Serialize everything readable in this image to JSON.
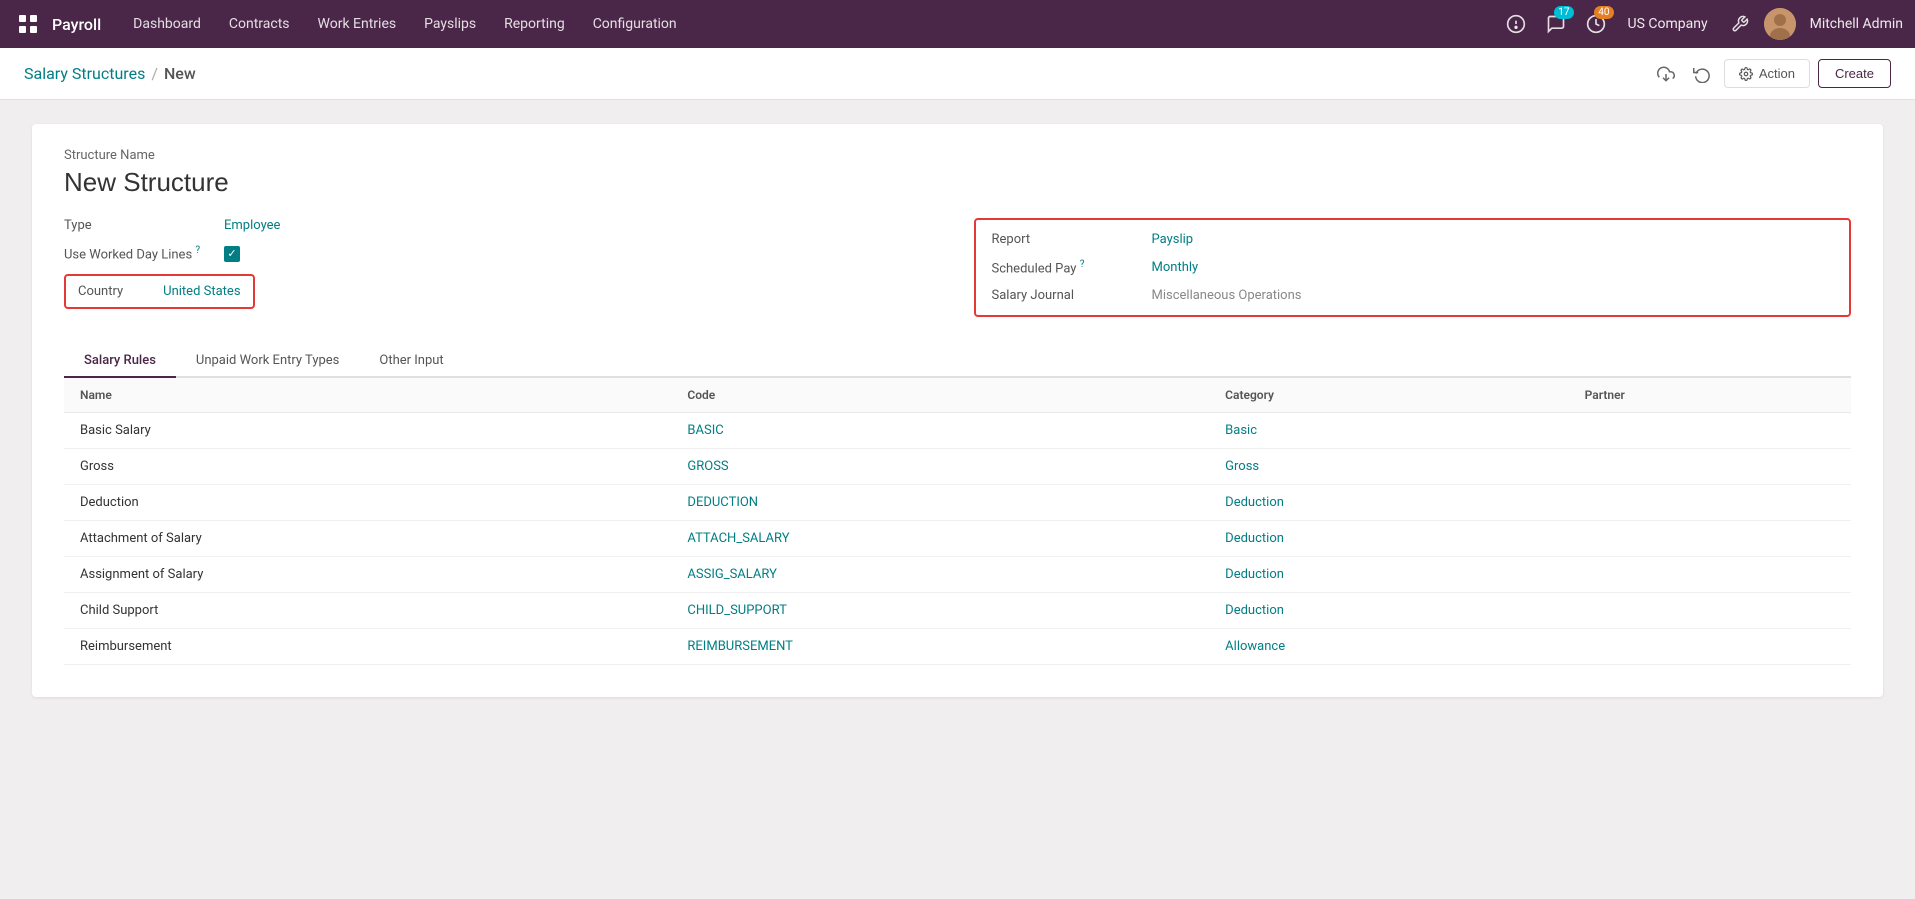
{
  "app": {
    "name": "Payroll",
    "nav_items": [
      "Dashboard",
      "Contracts",
      "Work Entries",
      "Payslips",
      "Reporting",
      "Configuration"
    ]
  },
  "topbar": {
    "chat_badge": "17",
    "activity_badge": "40",
    "company": "US Company",
    "user": "Mitchell Admin"
  },
  "breadcrumb": {
    "parent": "Salary Structures",
    "current": "New"
  },
  "toolbar": {
    "action_label": "Action",
    "create_label": "Create"
  },
  "form": {
    "structure_name_label": "Structure Name",
    "structure_name": "New Structure",
    "type_label": "Type",
    "type_value": "Employee",
    "use_worked_day_lines_label": "Use Worked Day Lines",
    "country_label": "Country",
    "country_value": "United States",
    "report_label": "Report",
    "report_value": "Payslip",
    "scheduled_pay_label": "Scheduled Pay",
    "scheduled_pay_value": "Monthly",
    "salary_journal_label": "Salary Journal",
    "salary_journal_value": "Miscellaneous Operations"
  },
  "tabs": [
    {
      "id": "salary-rules",
      "label": "Salary Rules",
      "active": true
    },
    {
      "id": "unpaid-work-entry-types",
      "label": "Unpaid Work Entry Types",
      "active": false
    },
    {
      "id": "other-input",
      "label": "Other Input",
      "active": false
    }
  ],
  "table": {
    "columns": [
      "Name",
      "Code",
      "Category",
      "Partner"
    ],
    "rows": [
      {
        "name": "Basic Salary",
        "code": "BASIC",
        "category": "Basic",
        "partner": ""
      },
      {
        "name": "Gross",
        "code": "GROSS",
        "category": "Gross",
        "partner": ""
      },
      {
        "name": "Deduction",
        "code": "DEDUCTION",
        "category": "Deduction",
        "partner": ""
      },
      {
        "name": "Attachment of Salary",
        "code": "ATTACH_SALARY",
        "category": "Deduction",
        "partner": ""
      },
      {
        "name": "Assignment of Salary",
        "code": "ASSIG_SALARY",
        "category": "Deduction",
        "partner": ""
      },
      {
        "name": "Child Support",
        "code": "CHILD_SUPPORT",
        "category": "Deduction",
        "partner": ""
      },
      {
        "name": "Reimbursement",
        "code": "REIMBURSEMENT",
        "category": "Allowance",
        "partner": ""
      }
    ]
  }
}
